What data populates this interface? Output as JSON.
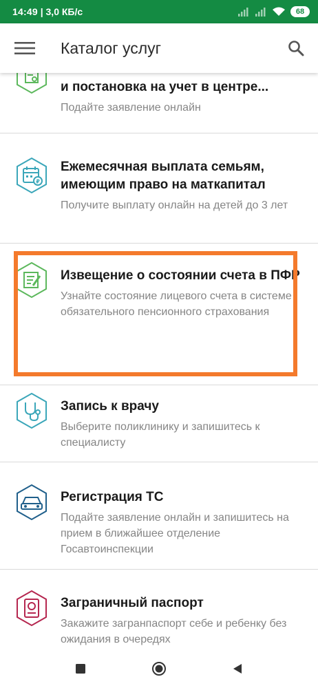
{
  "status_bar": {
    "time": "14:49",
    "speed": "3,0 КБ/с",
    "battery": "68"
  },
  "app_bar": {
    "title": "Каталог услуг",
    "menu_icon": "hamburger-menu-icon",
    "search_icon": "search-icon"
  },
  "services": [
    {
      "title": "и постановка на учет в центре...",
      "description": "Подайте заявление онлайн",
      "icon": "document-application-icon",
      "icon_color": "#5cb85c"
    },
    {
      "title": "Ежемесячная выплата семьям, имеющим право на маткапитал",
      "description": "Получите выплату онлайн на детей до 3 лет",
      "icon": "calendar-payment-icon",
      "icon_color": "#3aa6b9"
    },
    {
      "title": "Извещение о состоянии счета в ПФР",
      "description": "Узнайте состояние лицевого счета в системе обязательного пенсионного страхования",
      "icon": "document-edit-icon",
      "icon_color": "#5cb85c",
      "highlighted": true
    },
    {
      "title": "Запись к врачу",
      "description": "Выберите поликлинику и запишитесь к специалисту",
      "icon": "stethoscope-icon",
      "icon_color": "#3aa6b9"
    },
    {
      "title": "Регистрация ТС",
      "description": "Подайте заявление онлайн и запишитесь на прием в ближайшее отделение Госавтоинспекции",
      "icon": "car-icon",
      "icon_color": "#1f5f8b"
    },
    {
      "title": "Заграничный паспорт",
      "description": "Закажите загранпаспорт себе и ребенку без ожидания в очередях",
      "icon": "passport-icon",
      "icon_color": "#b5264f"
    }
  ],
  "colors": {
    "status_bar": "#148b43",
    "highlight": "#f47a2c",
    "text_secondary": "#858585"
  },
  "nav_bar": {
    "icons": [
      "recent-apps-icon",
      "home-icon",
      "back-icon"
    ]
  }
}
